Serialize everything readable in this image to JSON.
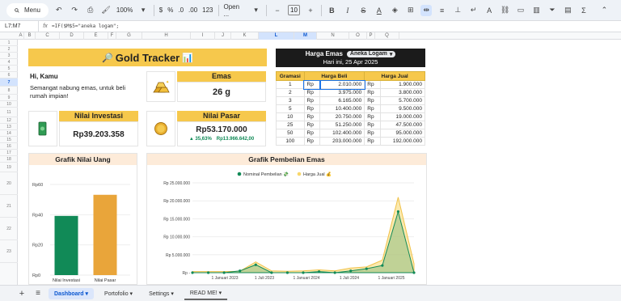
{
  "toolbar": {
    "menu_label": "Menu",
    "zoom": "100%",
    "currency": "$",
    "percent": "%",
    "dec_dec": ".0",
    "dec_inc": ".00",
    "number_format": "123",
    "font": "Open ...",
    "font_size": "10"
  },
  "formula_bar": {
    "name_box": "L7:M7",
    "fx": "fx",
    "formula": "=IF($M$5=\"aneka logam\";"
  },
  "columns": [
    "A",
    "B",
    "C",
    "D",
    "E",
    "F",
    "G",
    "H",
    "I",
    "J",
    "K",
    "L",
    "M",
    "N",
    "O",
    "P",
    "Q"
  ],
  "rows": [
    "1",
    "2",
    "3",
    "4",
    "5",
    "6",
    "7",
    "8",
    "9",
    "10",
    "11",
    "12",
    "13",
    "14",
    "15",
    "16",
    "17",
    "18",
    "19",
    "20",
    "21",
    "22",
    "23"
  ],
  "dashboard": {
    "title": "Gold Tracker",
    "title_emoji_left": "🔎",
    "title_emoji_right": "📊",
    "greeting": "Hi, Kamu",
    "message": "Semangat nabung emas, untuk beli rumah impian!",
    "emas_label": "Emas",
    "emas_value": "26 g",
    "investasi_label": "Nilai Investasi",
    "investasi_value": "Rp39.203.358",
    "pasar_label": "Nilai Pasar",
    "pasar_value": "Rp53.170.000",
    "pasar_change_pct": "▲ 35,63%",
    "pasar_change_abs": "Rp13.966.642,00"
  },
  "harga_emas": {
    "label": "Harga Emas",
    "dropdown": "Aneka Logam",
    "date": "Hari ini, 25 Apr 2025",
    "headers": [
      "Gramasi",
      "Harga Beli",
      "Harga Jual"
    ],
    "rows": [
      {
        "gram": "1",
        "cur_b": "Rp",
        "beli": "2.010.000",
        "cur_j": "Rp",
        "jual": "1.900.000"
      },
      {
        "gram": "2",
        "cur_b": "Rp",
        "beli": "3.975.000",
        "cur_j": "Rp",
        "jual": "3.800.000"
      },
      {
        "gram": "3",
        "cur_b": "Rp",
        "beli": "6.165.000",
        "cur_j": "Rp",
        "jual": "5.700.000"
      },
      {
        "gram": "5",
        "cur_b": "Rp",
        "beli": "10.400.000",
        "cur_j": "Rp",
        "jual": "9.500.000"
      },
      {
        "gram": "10",
        "cur_b": "Rp",
        "beli": "20.750.000",
        "cur_j": "Rp",
        "jual": "19.000.000"
      },
      {
        "gram": "25",
        "cur_b": "Rp",
        "beli": "51.250.000",
        "cur_j": "Rp",
        "jual": "47.500.000"
      },
      {
        "gram": "50",
        "cur_b": "Rp",
        "beli": "102.400.000",
        "cur_j": "Rp",
        "jual": "95.000.000"
      },
      {
        "gram": "100",
        "cur_b": "Rp",
        "beli": "203.000.000",
        "cur_j": "Rp",
        "jual": "192.000.000"
      }
    ]
  },
  "tabs": [
    "Dashboard",
    "Portofolio",
    "Settings",
    "READ ME!"
  ],
  "colors": {
    "accent": "#f6c84c",
    "green": "#118a57",
    "bar_orange": "#e9a53a",
    "area_yellow": "#f8d76b"
  },
  "chart_data": [
    {
      "type": "bar",
      "title": "Grafik Nilai Uang",
      "categories": [
        "Nilai Investasi",
        "Nilai Pasar"
      ],
      "values": [
        39203358,
        53170000
      ],
      "ylim": [
        0,
        60000000
      ],
      "yticks": [
        "Rp0",
        "Rp20",
        "Rp40",
        "Rp60"
      ]
    },
    {
      "type": "area",
      "title": "Grafik Pembelian Emas",
      "series": [
        {
          "name": "Nominal Pembelian 💸",
          "values": [
            0,
            0,
            0,
            0.5,
            2.2,
            0,
            0,
            0,
            0.3,
            0,
            0.5,
            1.1,
            2.0,
            17.0,
            0
          ]
        },
        {
          "name": "Harga Jual 💰",
          "values": [
            0.3,
            0.3,
            0.3,
            0.4,
            3.0,
            0.5,
            0.4,
            0.5,
            0.8,
            0.5,
            1.3,
            1.6,
            3.5,
            21.0,
            2.5
          ]
        }
      ],
      "x": [
        "2022-07",
        "2022-10",
        "2023-01",
        "2023-04",
        "2023-07",
        "2023-10",
        "2024-01",
        "2024-03",
        "2024-05",
        "2024-07",
        "2024-09",
        "2024-11",
        "2025-01",
        "2025-03",
        "2025-04"
      ],
      "xticks": [
        "1 Januari 2023",
        "1 Juli 2023",
        "1 Januari 2024",
        "1 Juli 2024",
        "1 Januari 2025"
      ],
      "yticks": [
        "Rp -",
        "Rp 5.000.000",
        "Rp 10.000.000",
        "Rp 15.000.000",
        "Rp 20.000.000",
        "Rp 25.000.000"
      ],
      "ylim": [
        0,
        25
      ],
      "y_unit": "juta Rp"
    }
  ]
}
